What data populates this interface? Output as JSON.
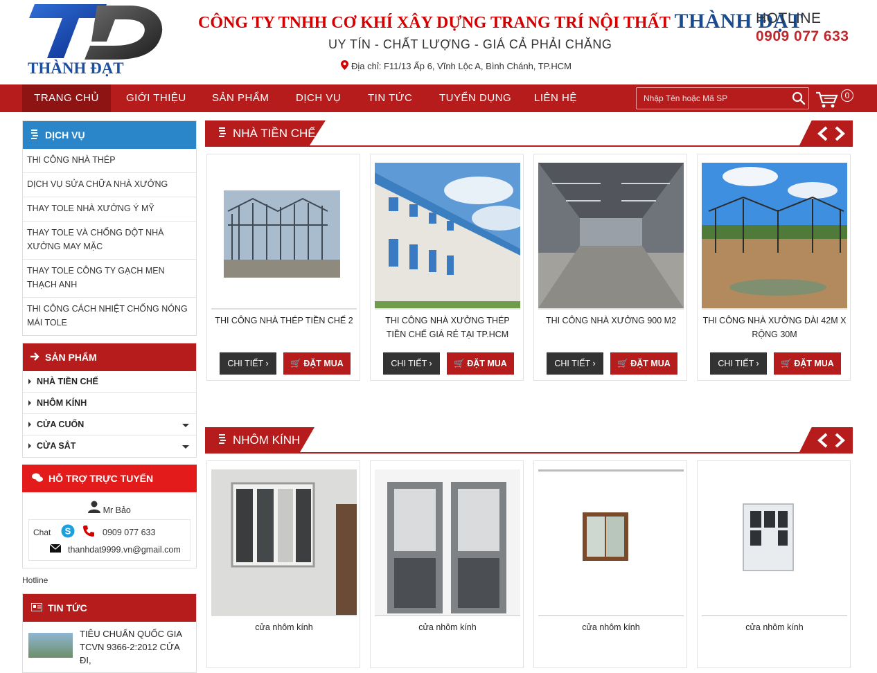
{
  "header": {
    "company_prefix": "CÔNG TY TNHH CƠ KHÍ XÂY DỰNG TRANG TRÍ NỘI THẤT",
    "company_brand": "THÀNH ĐẠT",
    "slogan": "UY TÍN - CHẤT LƯỢNG - GIÁ CẢ PHẢI CHĂNG",
    "address": "Địa chỉ: F11/13 Ấp 6, Vĩnh Lộc A, Bình Chánh, TP.HCM",
    "hotline_title": "HOTLINE",
    "hotline_number": "0909 077 633",
    "logo_text": "THÀNH ĐẠT"
  },
  "nav": {
    "items": [
      "TRANG CHỦ",
      "GIỚI THIỆU",
      "SẢN PHẨM",
      "DỊCH VỤ",
      "TIN TỨC",
      "TUYỂN DỤNG",
      "LIÊN HỆ"
    ],
    "search_placeholder": "Nhập Tên hoặc Mã SP",
    "cart_count": "0"
  },
  "sidebar": {
    "services_title": "DỊCH VỤ",
    "services": [
      "THI CÔNG NHÀ THÉP",
      "DỊCH VỤ SỬA CHỮA NHÀ XƯỞNG",
      "THAY TOLE NHÀ XƯỞNG Ý MỸ",
      "THAY TOLE VÀ CHỐNG DỘT NHÀ XƯỞNG MAY MẶC",
      "THAY TOLE CÔNG TY GẠCH MEN THẠCH ANH",
      "THI CÔNG CÁCH NHIỆT CHỐNG NÓNG MÁI TOLE"
    ],
    "products_title": "SẢN PHẨM",
    "products": [
      "NHÀ TIỀN CHẾ",
      "NHÔM KÍNH",
      "CỬA CUỐN",
      "CỬA SẮT"
    ],
    "support_title": "HỖ TRỢ TRỰC TUYẾN",
    "support_person": "Mr Bảo",
    "support_chat": "Chat",
    "support_phone": "0909 077 633",
    "support_email": "thanhdat9999.vn@gmail.com",
    "hotline_label": "Hotline",
    "news_title": "TIN TỨC",
    "news_item": "TIÊU CHUẨN QUỐC GIA TCVN 9366-2:2012 CỬA ĐI,"
  },
  "sections": [
    {
      "title": "NHÀ TIỀN CHẾ",
      "products": [
        {
          "name": "THI CÔNG NHÀ THÉP TIỀN CHẾ 2",
          "detail": "CHI TIẾT",
          "buy": "ĐẶT MUA"
        },
        {
          "name": "THI CÔNG NHÀ XƯỞNG THÉP TIỀN CHẾ GIÁ RẺ TẠI TP.HCM",
          "detail": "CHI TIẾT",
          "buy": "ĐẶT MUA"
        },
        {
          "name": "THI CÔNG NHÀ XƯỞNG 900 M2",
          "detail": "CHI TIẾT",
          "buy": "ĐẶT MUA"
        },
        {
          "name": "THI CÔNG NHÀ XƯỞNG DÀI 42M X RỘNG 30M",
          "detail": "CHI TIẾT",
          "buy": "ĐẶT MUA"
        }
      ]
    },
    {
      "title": "NHÔM KÍNH",
      "products": [
        {
          "name": "cửa nhôm kính"
        },
        {
          "name": "cửa nhôm kính"
        },
        {
          "name": "cửa nhôm kính"
        },
        {
          "name": "cửa nhôm kính"
        }
      ]
    }
  ],
  "colors": {
    "primary_red": "#b71c1c",
    "blue": "#2a86c8",
    "bright_red": "#e31b1b",
    "brand_blue": "#1a4b8f"
  }
}
